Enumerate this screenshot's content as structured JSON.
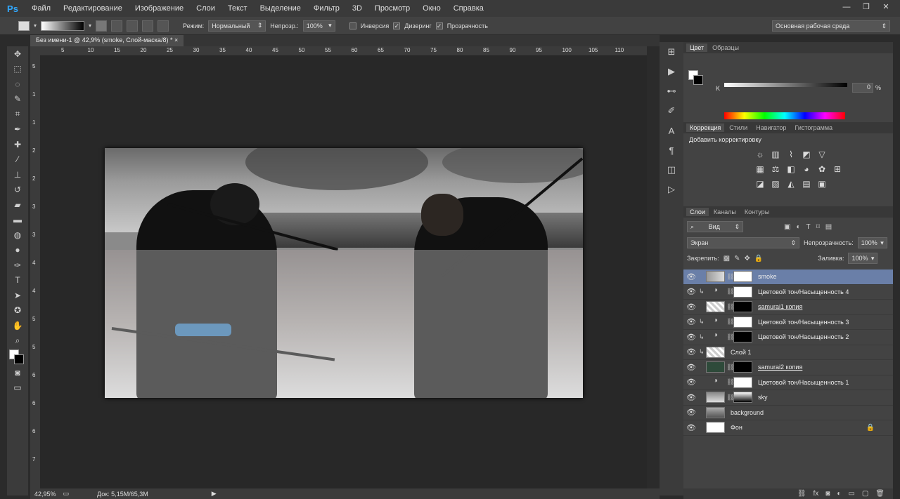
{
  "app": {
    "logo": "Ps"
  },
  "menu": [
    "Файл",
    "Редактирование",
    "Изображение",
    "Слои",
    "Текст",
    "Выделение",
    "Фильтр",
    "3D",
    "Просмотр",
    "Окно",
    "Справка"
  ],
  "window_buttons": [
    "—",
    "❐",
    "✕"
  ],
  "options": {
    "mode_label": "Режим:",
    "mode_value": "Нормальный",
    "opacity_label": "Непрозр.:",
    "opacity_value": "100%",
    "inverse_label": "Инверсия",
    "dither_label": "Дизеринг",
    "transparency_label": "Прозрачность",
    "workspace": "Основная рабочая среда"
  },
  "document_tab": "Без имени-1 @ 42,9% (smoke, Слой-маска/8) *",
  "ruler_top": [
    "5",
    "10",
    "15",
    "20",
    "25",
    "30",
    "35",
    "40",
    "45",
    "50",
    "55",
    "60",
    "65",
    "70",
    "75",
    "80",
    "85",
    "90",
    "95",
    "100",
    "105",
    "110"
  ],
  "ruler_left": [
    "5",
    "1",
    "1",
    "2",
    "2",
    "3",
    "3",
    "4",
    "4",
    "5",
    "5",
    "6",
    "6",
    "6",
    "7"
  ],
  "color_panel": {
    "tabs": [
      "Цвет",
      "Образцы"
    ],
    "channel": "K",
    "value": "0",
    "unit": "%"
  },
  "adjust_panel": {
    "tabs": [
      "Коррекция",
      "Стили",
      "Навигатор",
      "Гистограмма"
    ],
    "title": "Добавить корректировку"
  },
  "layers_panel": {
    "tabs": [
      "Слои",
      "Каналы",
      "Контуры"
    ],
    "filter": "Вид",
    "blend_mode": "Экран",
    "opacity_label": "Непрозрачность:",
    "opacity_value": "100%",
    "lock_label": "Закрепить:",
    "fill_label": "Заливка:",
    "fill_value": "100%",
    "layers": [
      {
        "name": "smoke",
        "selected": true
      },
      {
        "name": "Цветовой тон/Насыщенность 4"
      },
      {
        "name": "samurai1 копия"
      },
      {
        "name": "Цветовой тон/Насыщенность 3"
      },
      {
        "name": "Цветовой тон/Насыщенность 2"
      },
      {
        "name": "Слой 1"
      },
      {
        "name": "samurai2 копия"
      },
      {
        "name": "Цветовой тон/Насыщенность 1"
      },
      {
        "name": "sky"
      },
      {
        "name": "background"
      },
      {
        "name": "Фон"
      }
    ]
  },
  "status": {
    "zoom": "42,95%",
    "doc": "Док: 5,15M/65,3M"
  },
  "colors": {
    "accent": "#31a8ff",
    "selected_layer": "#6a7fa8"
  }
}
